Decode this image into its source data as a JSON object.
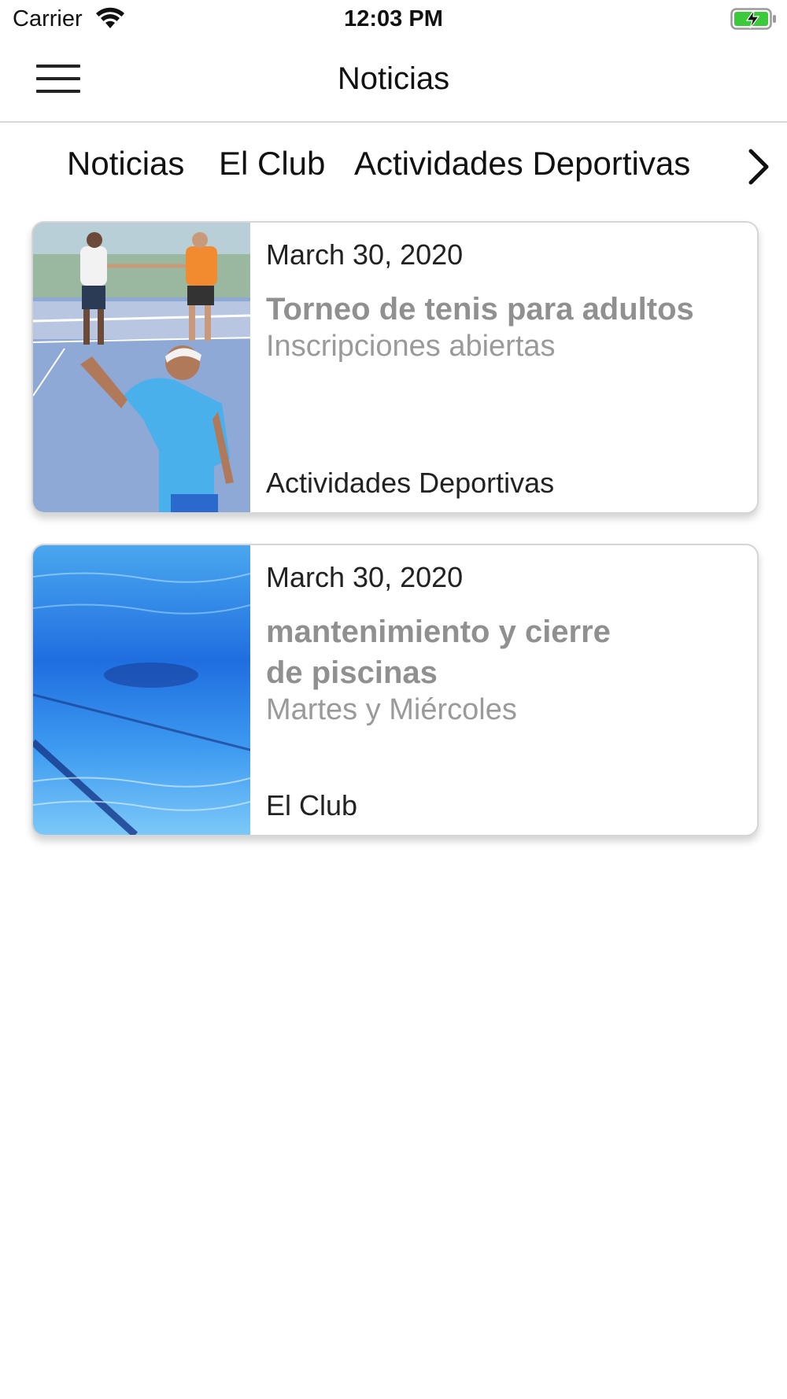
{
  "status_bar": {
    "carrier": "Carrier",
    "time": "12:03 PM",
    "battery_color": "#3cc93c"
  },
  "nav": {
    "title": "Noticias"
  },
  "tabs": [
    {
      "label": "Noticias"
    },
    {
      "label": "El Club"
    },
    {
      "label": "Actividades Deportivas"
    }
  ],
  "news": [
    {
      "date": "March 30, 2020",
      "title": "Torneo de tenis para adultos",
      "subtitle": "Inscripciones abiertas",
      "category": "Actividades Deportivas",
      "image": "tennis-players-photo"
    },
    {
      "date": "March 30, 2020",
      "title": "mantenimiento y cierre de piscinas",
      "subtitle": "Martes y Miércoles",
      "category": "El Club",
      "image": "swimming-pool-photo"
    }
  ]
}
